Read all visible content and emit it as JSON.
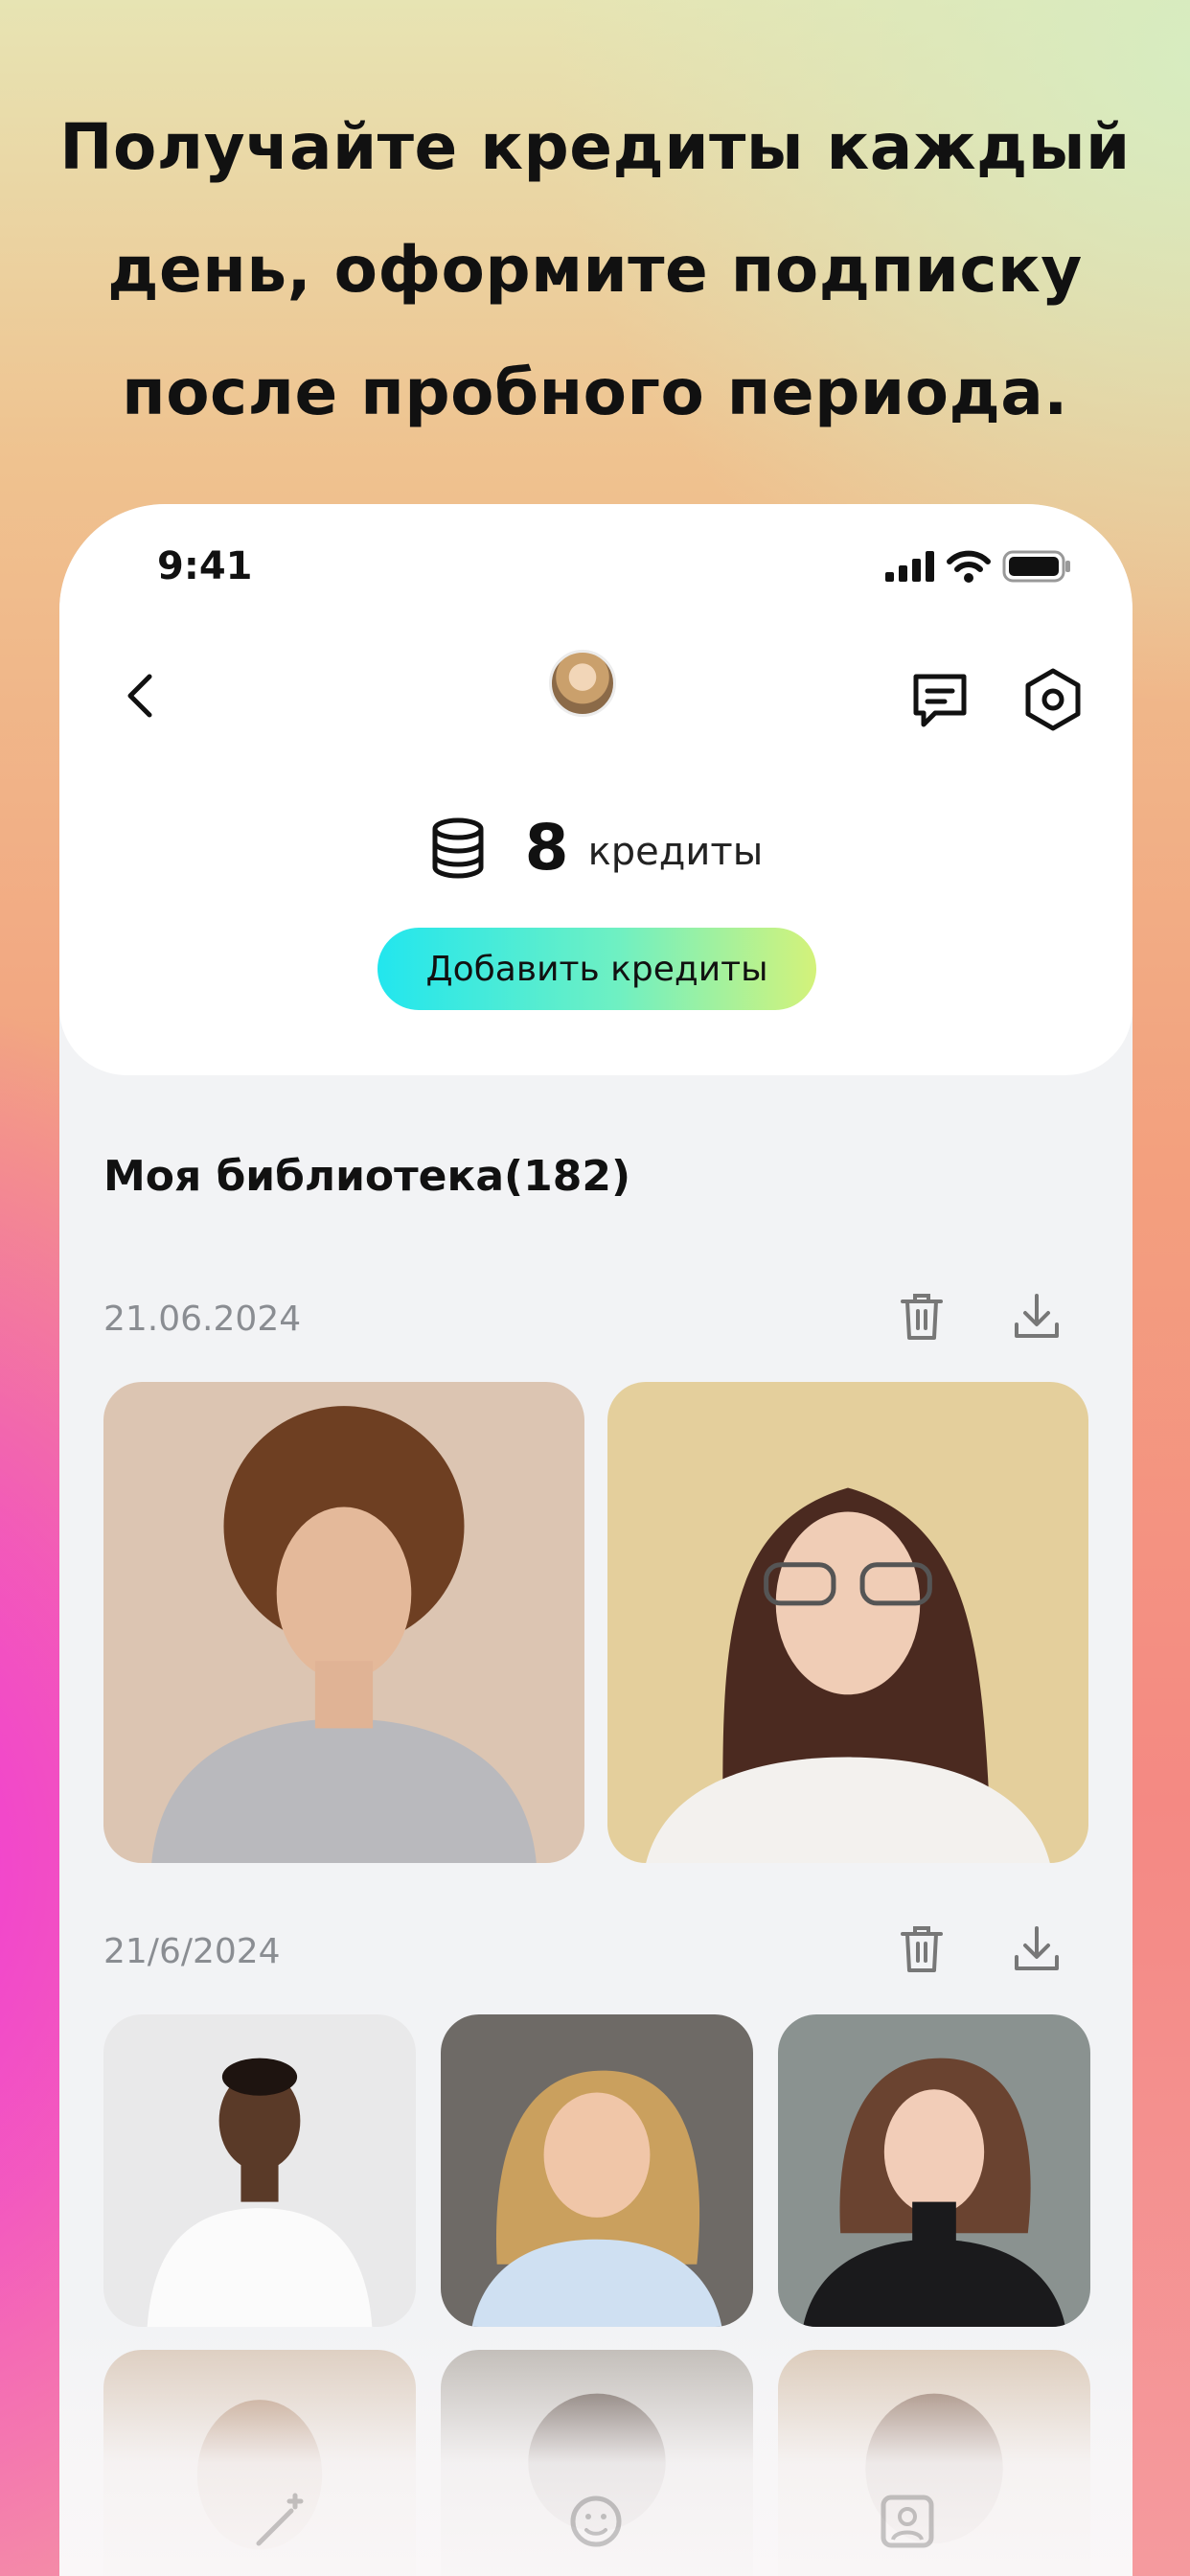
{
  "headline": {
    "line1": "Получайте кредиты каждый",
    "line2": "день, оформите подписку",
    "line3": "после пробного периода."
  },
  "status_bar": {
    "time": "9:41"
  },
  "credits": {
    "count": "8",
    "label": "кредиты",
    "add_button": "Добавить кредиты"
  },
  "library": {
    "title": "Моя библиотека(182)",
    "groups": [
      {
        "date": "21.06.2024"
      },
      {
        "date": "21/6/2024"
      }
    ]
  },
  "icons": {
    "back": "chevron-left-icon",
    "chat": "message-icon",
    "settings": "settings-hexagon-icon",
    "coins": "coins-stack-icon",
    "delete": "trash-icon",
    "download": "download-icon"
  },
  "colors": {
    "accent_gradient_start": "#22e6ee",
    "accent_gradient_end": "#d4f27a",
    "date_text": "#8a8d92"
  }
}
